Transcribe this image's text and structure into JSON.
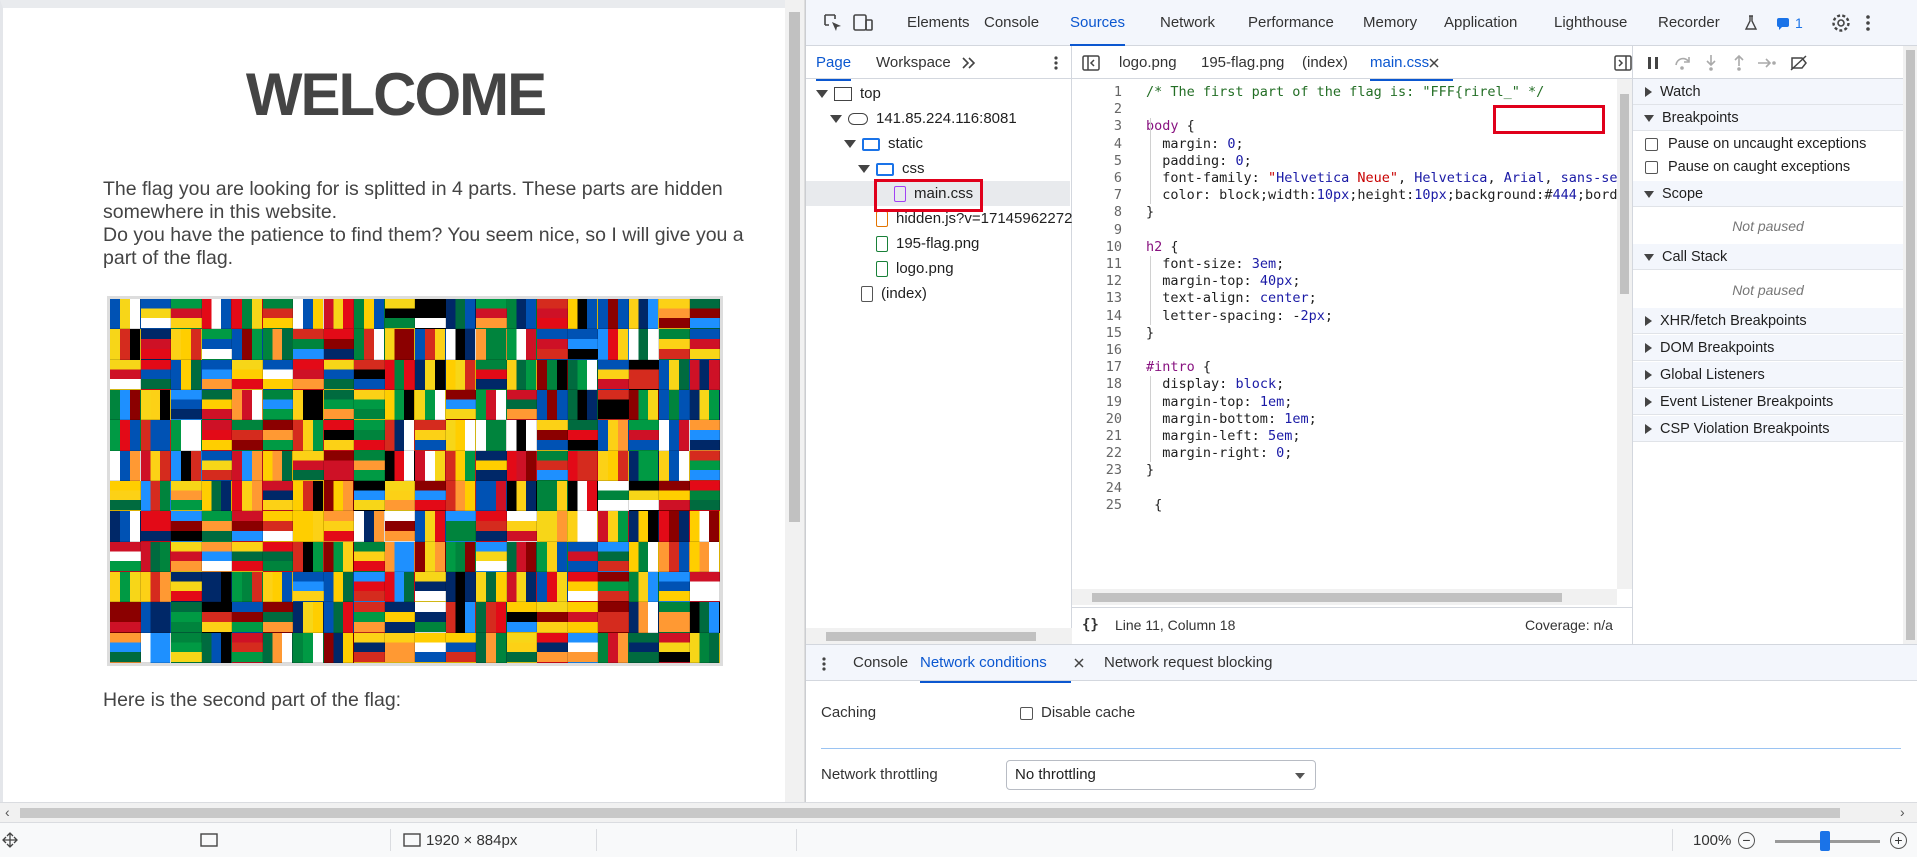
{
  "page": {
    "heading": "WELCOME",
    "intro_line1": "The flag you are looking for is splitted in 4 parts. These parts are hidden somewhere in this website.",
    "intro_line2": "Do you have the patience to find them? You seem nice, so I will give you a part of the flag.",
    "second_part": "Here is the second part of the flag:"
  },
  "devtools": {
    "main_tabs": [
      "Elements",
      "Console",
      "Sources",
      "Network",
      "Performance",
      "Memory",
      "Application",
      "Lighthouse",
      "Recorder"
    ],
    "active_tab": "Sources",
    "issues_count": "1",
    "nav_tabs": [
      "Page",
      "Workspace"
    ],
    "tree": {
      "top": "top",
      "host": "141.85.224.116:8081",
      "static": "static",
      "css": "css",
      "main_css": "main.css",
      "hidden_js": "hidden.js?v=17145962272",
      "flag_png": "195-flag.png",
      "logo_png": "logo.png",
      "index": "(index)"
    },
    "editor_tabs": [
      "logo.png",
      "195-flag.png",
      "(index)",
      "main.css"
    ],
    "status_position": "Line 11, Column 18",
    "coverage": "Coverage: n/a",
    "debug": {
      "watch": "Watch",
      "breakpoints": "Breakpoints",
      "pause_uncaught": "Pause on uncaught exceptions",
      "pause_caught": "Pause on caught exceptions",
      "scope": "Scope",
      "not_paused_scope": "Not paused",
      "call_stack": "Call Stack",
      "not_paused_stack": "Not paused",
      "xhr": "XHR/fetch Breakpoints",
      "dom": "DOM Breakpoints",
      "global": "Global Listeners",
      "event": "Event Listener Breakpoints",
      "csp": "CSP Violation Breakpoints"
    },
    "drawer_tabs": [
      "Console",
      "Network conditions",
      "Network request blocking"
    ],
    "caching_label": "Caching",
    "disable_cache_label": "Disable cache",
    "throttling_label": "Network throttling",
    "throttling_value": "No throttling"
  },
  "code_lines": [
    "/* The first part of the flag is: \"FFF{rirel_\" */",
    "",
    "body {",
    "  margin: 0;",
    "  padding: 0;",
    "  font-family: \"Helvetica Neue\", Helvetica, Arial, sans-se",
    "  color: #444;",
    "}",
    "",
    "h2 {",
    "  font-size: 3em;",
    "  margin-top: 40px;",
    "  text-align: center;",
    "  letter-spacing: -2px;",
    "}",
    "",
    "#intro {",
    "  display: block;",
    "  margin-top: 1em;",
    "  margin-bottom: 1em;",
    "  margin-left: 5em;",
    "  margin-right: 0;",
    "}",
    "",
    "  {"
  ],
  "status_bar": {
    "dimensions": "1920 × 884px",
    "zoom": "100%"
  },
  "colors": {
    "accent": "#0b57d0",
    "highlight_box": "#e0001b"
  }
}
